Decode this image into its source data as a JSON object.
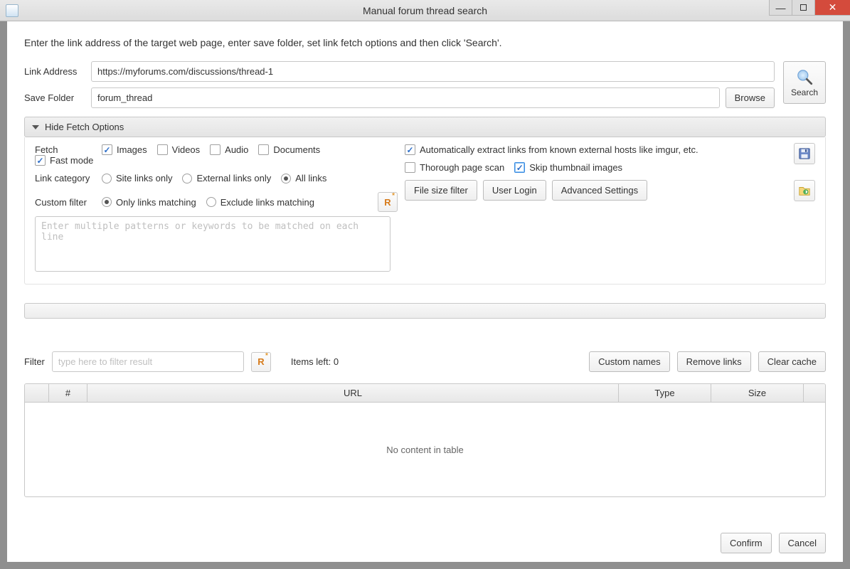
{
  "window": {
    "title": "Manual forum thread search"
  },
  "instructions": "Enter the link address of the target web page, enter save folder, set link fetch options and then click 'Search'.",
  "link_address": {
    "label": "Link Address",
    "value": "https://myforums.com/discussions/thread-1"
  },
  "save_folder": {
    "label": "Save Folder",
    "value": "forum_thread",
    "browse": "Browse"
  },
  "search_button": "Search",
  "fetch_header": "Hide Fetch Options",
  "fetch": {
    "label": "Fetch",
    "images": {
      "label": "Images",
      "checked": true
    },
    "videos": {
      "label": "Videos",
      "checked": false
    },
    "audio": {
      "label": "Audio",
      "checked": false
    },
    "documents": {
      "label": "Documents",
      "checked": false
    },
    "fast_mode": {
      "label": "Fast mode",
      "checked": true
    }
  },
  "link_category": {
    "label": "Link category",
    "site_only": "Site links only",
    "external_only": "External links only",
    "all": "All links",
    "selected": "all"
  },
  "custom_filter": {
    "label": "Custom filter",
    "only": "Only links matching",
    "exclude": "Exclude links matching",
    "selected": "only",
    "textarea_placeholder": "Enter multiple patterns or keywords to be matched on each line"
  },
  "right_opts": {
    "auto_extract": {
      "label": "Automatically extract links from known external hosts like imgur, etc.",
      "checked": true
    },
    "thorough": {
      "label": "Thorough page scan",
      "checked": false
    },
    "skip_thumb": {
      "label": "Skip thumbnail images",
      "checked": true
    },
    "file_size_filter": "File size filter",
    "user_login": "User Login",
    "advanced": "Advanced Settings"
  },
  "filter_bar": {
    "label": "Filter",
    "placeholder": "type here to filter result",
    "items_left": "Items left: 0",
    "custom_names": "Custom names",
    "remove_links": "Remove links",
    "clear_cache": "Clear cache"
  },
  "table": {
    "columns": {
      "num": "#",
      "url": "URL",
      "type": "Type",
      "size": "Size"
    },
    "empty": "No content in table"
  },
  "footer": {
    "confirm": "Confirm",
    "cancel": "Cancel"
  }
}
